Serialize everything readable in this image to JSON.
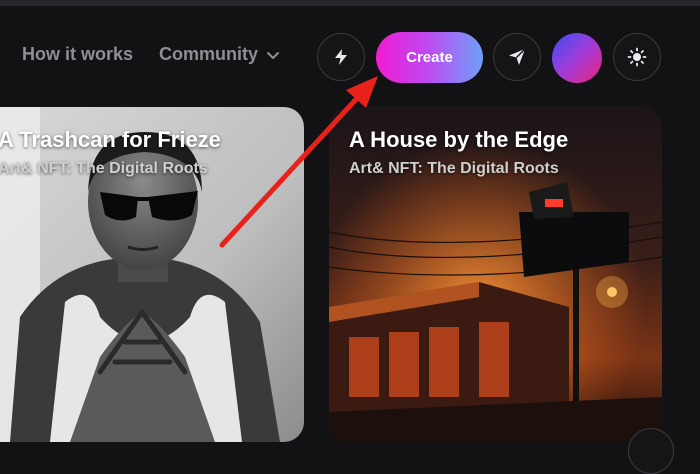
{
  "nav": {
    "how_it_works": "How it works",
    "community": "Community"
  },
  "toolbar": {
    "create_label": "Create"
  },
  "cards": [
    {
      "title": "A Trashcan for Frieze",
      "subtitle": "Art& NFT: The Digital Roots"
    },
    {
      "title": "A House by the Edge",
      "subtitle": "Art& NFT: The Digital Roots"
    }
  ],
  "colors": {
    "background": "#121214",
    "nav_text": "#8e8e95",
    "create_gradient_start": "#f21bd1",
    "create_gradient_end": "#6fa0f8",
    "annotation_arrow": "#e8221b"
  },
  "icons": [
    "lightning-icon",
    "send-icon",
    "avatar",
    "sun-icon",
    "chevron-down-icon"
  ]
}
